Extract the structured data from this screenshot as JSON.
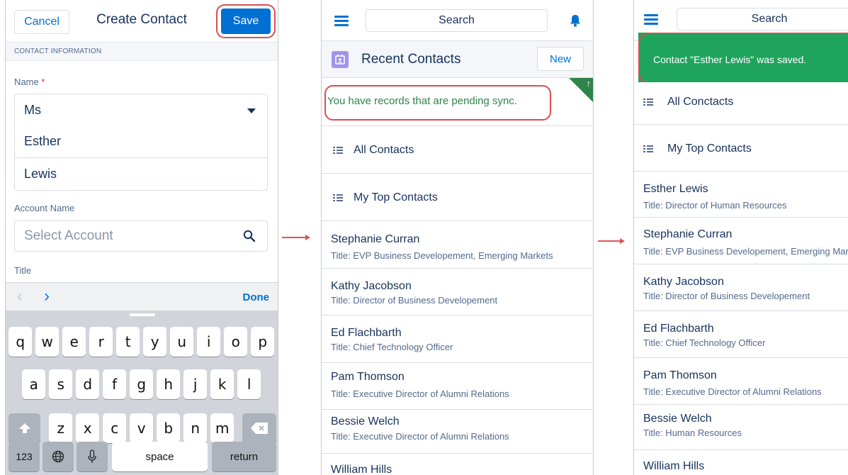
{
  "create_contact": {
    "cancel_label": "Cancel",
    "title": "Create Contact",
    "save_label": "Save",
    "section_label": "CONTACT INFORMATION",
    "name_label": "Name",
    "required_mark": "*",
    "salutation_value": "Ms",
    "first_name_value": "Esther",
    "last_name_value": "Lewis",
    "account_label": "Account Name",
    "account_placeholder": "Select Account",
    "title_label": "Title",
    "done_label": "Done"
  },
  "keyboard": {
    "row1": [
      "q",
      "w",
      "e",
      "r",
      "t",
      "y",
      "u",
      "i",
      "o",
      "p"
    ],
    "row2": [
      "a",
      "s",
      "d",
      "f",
      "g",
      "h",
      "j",
      "k",
      "l"
    ],
    "row3": [
      "z",
      "x",
      "c",
      "v",
      "b",
      "n",
      "m"
    ],
    "numbers_label": "123",
    "space_label": "space",
    "return_label": "return"
  },
  "recent_contacts": {
    "search_label": "Search",
    "header_title": "Recent Contacts",
    "new_label": "New",
    "pending_message": "You have records that are pending sync.",
    "list_views": [
      {
        "label": "All Contacts"
      },
      {
        "label": "My Top Contacts"
      }
    ],
    "contacts": [
      {
        "name": "Stephanie Curran",
        "title": "Title: EVP Business Developement, Emerging Markets"
      },
      {
        "name": "Kathy Jacobson",
        "title": "Title: Director of Business Developement"
      },
      {
        "name": "Ed Flachbarth",
        "title": "Title: Chief Technology Officer"
      },
      {
        "name": "Pam Thomson",
        "title": "Title: Executive Director of Alumni Relations"
      },
      {
        "name": "Bessie Welch",
        "title": "Title: Executive Director of Alumni Relations"
      },
      {
        "name": "William Hills",
        "title": ""
      }
    ]
  },
  "saved_view": {
    "search_label": "Search",
    "toast_message": "Contact \"Esther Lewis\" was saved.",
    "list_views": [
      {
        "label": "All Conctacts"
      },
      {
        "label": "My Top Contacts"
      }
    ],
    "contacts": [
      {
        "name": "Esther Lewis",
        "title": "Title: Director of Human Resources"
      },
      {
        "name": "Stephanie Curran",
        "title": "Title: EVP Business Developement, Emerging Markets"
      },
      {
        "name": "Kathy Jacobson",
        "title": "Title: Director of Business Developement"
      },
      {
        "name": "Ed Flachbarth",
        "title": "Title: Chief Technology Officer"
      },
      {
        "name": "Pam Thomson",
        "title": "Title: Executive Director of Alumni Relations"
      },
      {
        "name": "Bessie Welch",
        "title": "Title: Human Resources"
      },
      {
        "name": "William Hills",
        "title": ""
      }
    ]
  },
  "colors": {
    "brand_blue": "#0070d2",
    "sync_green": "#2e844a",
    "toast_green": "#1fa45d",
    "highlight_red": "#d94f4f"
  }
}
